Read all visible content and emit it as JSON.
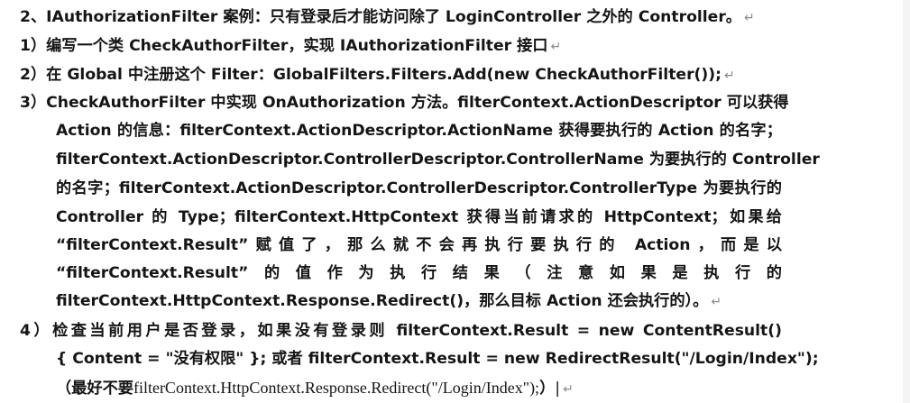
{
  "document": {
    "heading": "2、IAuthorizationFilter 案例：只有登录后才能访问除了 LoginController 之外的 Controller。",
    "step1": "1）编写一个类 CheckAuthorFilter，实现 IAuthorizationFilter 接口",
    "step2": "2）在 Global 中注册这个 Filter：GlobalFilters.Filters.Add(new CheckAuthorFilter());",
    "step3_lines": [
      "3）CheckAuthorFilter 中实现 OnAuthorization 方法。filterContext.ActionDescriptor 可以获得",
      "Action 的信息：filterContext.ActionDescriptor.ActionName 获得要执行的 Action 的名字；",
      "filterContext.ActionDescriptor.ControllerDescriptor.ControllerName 为要执行的 Controller",
      "的名字；filterContext.ActionDescriptor.ControllerDescriptor.ControllerType 为要执行的",
      "Controller 的 Type；filterContext.HttpContext 获得当前请求的 HttpContext；如果给",
      "“filterContext.Result”赋值了，那么就不会再执行要执行的 Action，而是以",
      "“filterContext.Result”的值作为执行结果（注意如果是执行的",
      "filterContext.HttpContext.Response.Redirect()，那么目标 Action 还会执行的）。"
    ],
    "step4_lines": [
      "4）检查当前用户是否登录，如果没有登录则 filterContext.Result = new ContentResult()",
      "{ Content = \"没有权限\" }; 或者 filterContext.Result = new RedirectResult(\"/Login/Index\");"
    ],
    "step4_last_prefix": "（最好不要",
    "step4_last_code": "filterContext.HttpContext.Response.Redirect(\"/Login/Index\");",
    "step4_last_suffix": "）",
    "paragraph_mark": "↵"
  }
}
